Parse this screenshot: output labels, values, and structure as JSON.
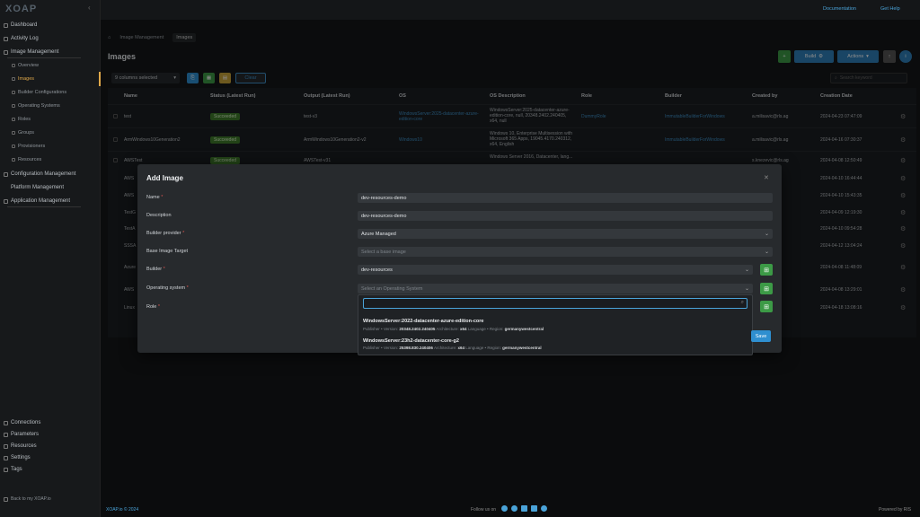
{
  "app": {
    "logo": "XOAP"
  },
  "sidebar": {
    "items": [
      {
        "label": "Dashboard",
        "icon": "dashboard-icon"
      },
      {
        "label": "Activity Log",
        "icon": "clock-icon"
      },
      {
        "label": "Image Management",
        "icon": "image-icon"
      }
    ],
    "subitems": [
      {
        "label": "Overview"
      },
      {
        "label": "Images"
      },
      {
        "label": "Builder Configurations"
      },
      {
        "label": "Operating Systems"
      },
      {
        "label": "Roles"
      },
      {
        "label": "Groups"
      },
      {
        "label": "Provisioners"
      },
      {
        "label": "Resources"
      }
    ],
    "sections": [
      {
        "label": "Configuration Management"
      },
      {
        "label": "Platform Management"
      },
      {
        "label": "Application Management"
      }
    ],
    "bottom": [
      {
        "label": "Connections",
        "icon": "link-icon"
      },
      {
        "label": "Parameters",
        "icon": "sliders-icon"
      },
      {
        "label": "Resources",
        "icon": "box-icon"
      },
      {
        "label": "Settings",
        "icon": "gear-icon"
      },
      {
        "label": "Tags",
        "icon": "tag-icon"
      }
    ],
    "back_link": "Back to my XOAP.io"
  },
  "topbar": {
    "documentation": "Documentation",
    "get_help": "Get Help"
  },
  "breadcrumb": {
    "root": "Image Management",
    "current": "Images"
  },
  "page": {
    "title": "Images"
  },
  "toolbar": {
    "columns_selected": "9 columns selected",
    "clear": "Clear",
    "build": "Build",
    "actions": "Actions",
    "search_placeholder": "Search keyword"
  },
  "table": {
    "headers": [
      "Name",
      "Status (Latest Run)",
      "Output (Latest Run)",
      "OS",
      "OS Description",
      "Role",
      "Builder",
      "Created by",
      "Creation Date"
    ],
    "rows": [
      {
        "name": "test",
        "status": "Succeeded",
        "output": "test-v3",
        "os": "WindowsServer:2025-datacenter-azure-edition-core",
        "desc": "WindowsServer:2025-datacenter-azure-edition-core, null, 20348.2402.240405, x64, null",
        "role": "DummyRole",
        "builder": "ImmutableBuilderForWindows",
        "created_by": "a.milisavic@rls.ag",
        "date": "2024-04-23 07:47:09"
      },
      {
        "name": "ArmWindows10Generation2",
        "status": "Succeeded",
        "output": "ArmWindows10Generation2-v2",
        "os": "Windows10",
        "desc": "Windows 10, Enterprise Multisession with Microsoft 365 Apps, 19045.4170.240312, x64, English",
        "role": "",
        "builder": "ImmutableBuilderForWindows",
        "created_by": "a.milisavic@rls.ag",
        "date": "2024-04-16 07:30:37"
      },
      {
        "name": "AWSTest",
        "status": "Succeeded",
        "output": "AWSTest-v31",
        "os": "",
        "desc": "Windows Server 2016, Datacenter, lang...",
        "role": "",
        "builder": "",
        "created_by": "s.knezevic@rls.ag",
        "date": "2024-04-08 12:50:49"
      },
      {
        "name": "AWS",
        "date": "2024-04-10 16:44:44"
      },
      {
        "name": "AWS",
        "date": "2024-04-10 15:43:35"
      },
      {
        "name": "TestG",
        "date": "2024-04-09 12:19:30"
      },
      {
        "name": "TestA",
        "date": "2024-04-10 09:54:28"
      },
      {
        "name": "SSSA",
        "date": "2024-04-12 13:04:24"
      },
      {
        "name": "Azure",
        "date": "2024-04-08 11:48:09"
      },
      {
        "name": "AWS",
        "date": "2024-04-08 13:29:01"
      },
      {
        "name": "Linux",
        "date": "2024-04-18 13:08:16"
      }
    ]
  },
  "modal": {
    "title": "Add Image",
    "fields": {
      "name": {
        "label": "Name",
        "value": "dev-resources-demo"
      },
      "description": {
        "label": "Description",
        "value": "dev-resources-demo"
      },
      "builder_provider": {
        "label": "Builder provider",
        "value": "Azure Managed"
      },
      "base_image_target": {
        "label": "Base Image Target",
        "placeholder": "Select a base image"
      },
      "builder": {
        "label": "Builder",
        "value": "dev-resources"
      },
      "operating_system": {
        "label": "Operating system",
        "placeholder": "Select an Operating System"
      },
      "role": {
        "label": "Role"
      }
    },
    "dropdown_options": [
      {
        "title": "WindowsServer:2022-datacenter-azure-edition-core",
        "publisher": "Publisher",
        "publisher_value": "",
        "version_label": "Version",
        "version": "20348.2402.240405",
        "arch_label": "Architecture",
        "arch": "x64",
        "lang_label": "Language",
        "region_label": "Region",
        "region": "germanywestcentral"
      },
      {
        "title": "WindowsServer:23h2-datacenter-core-g2",
        "publisher": "Publisher",
        "publisher_value": "",
        "version_label": "Version",
        "version": "25398.830.240406",
        "arch_label": "Architecture",
        "arch": "x64",
        "lang_label": "Language",
        "region_label": "Region",
        "region": "germanywestcentral"
      }
    ],
    "save": "Save"
  },
  "footer": {
    "brand": "XOAP.io © 2024",
    "follow": "Follow us on",
    "powered": "Powered by RIS"
  }
}
